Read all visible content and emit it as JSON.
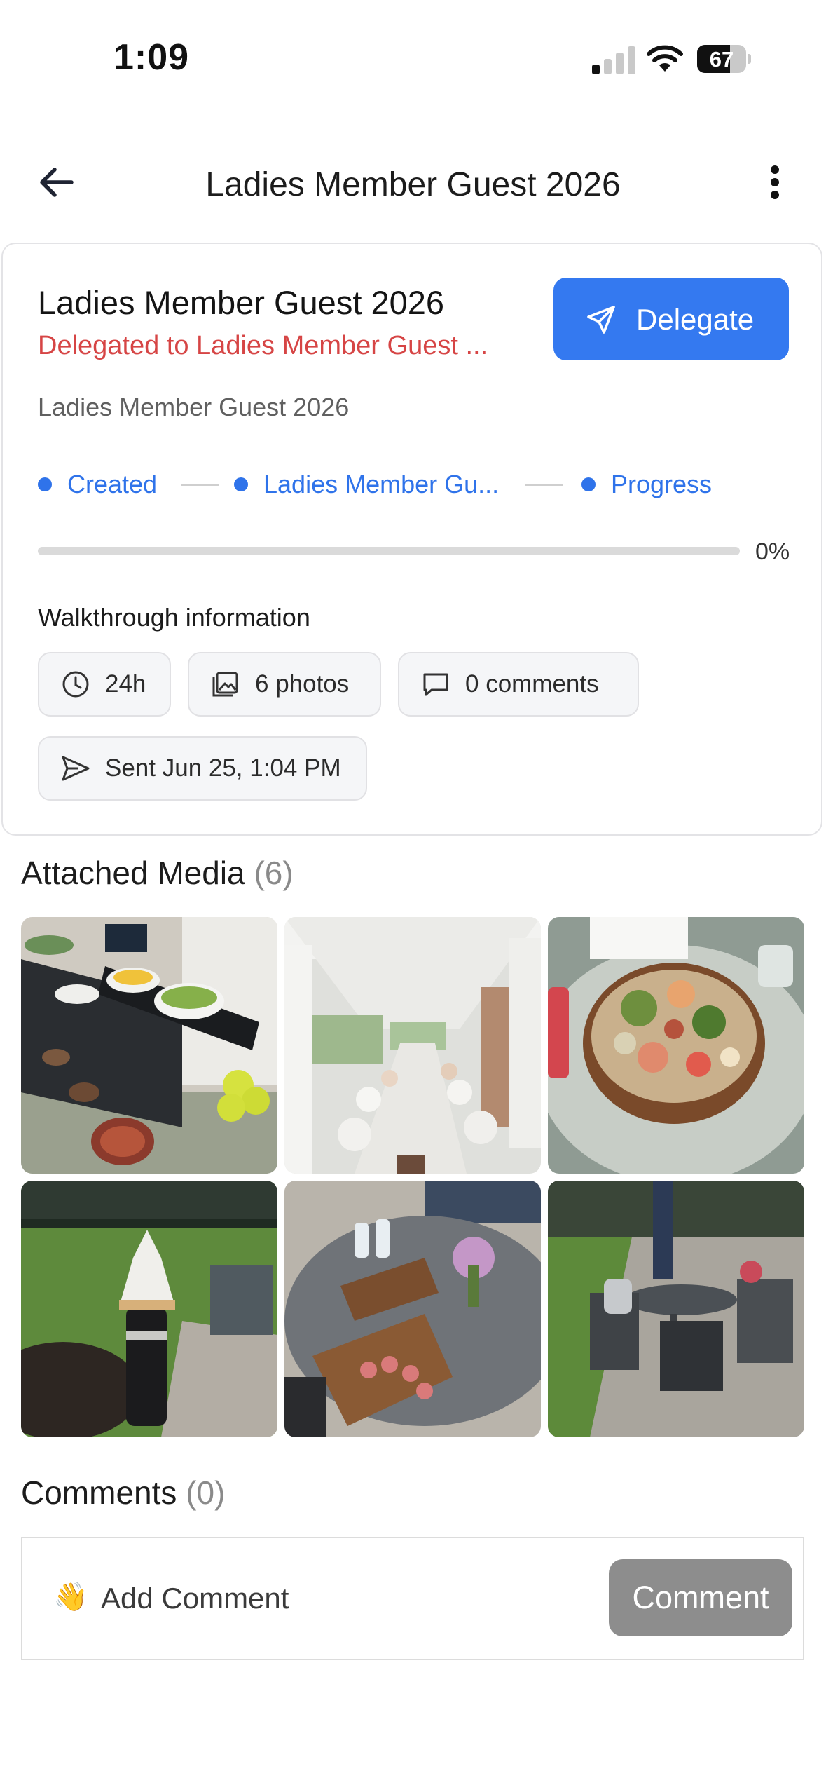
{
  "status_bar": {
    "time": "1:09",
    "battery_percent": "67",
    "battery_level": 0.67,
    "signal_bars_active": 1,
    "icons": [
      "cellular-signal-icon",
      "wifi-icon",
      "battery-icon"
    ]
  },
  "header": {
    "title": "Ladies Member Guest 2026",
    "back_icon": "arrow-left-icon",
    "menu_icon": "more-vertical-icon"
  },
  "card": {
    "title": "Ladies Member Guest 2026",
    "delegated_to": "Delegated to Ladies Member Guest ...",
    "description": "Ladies Member Guest 2026",
    "delegate_button": "Delegate",
    "delegate_icon": "send-outline-icon",
    "steps": [
      {
        "label": "Created"
      },
      {
        "label": "Ladies Member Gu..."
      },
      {
        "label": "Progress"
      }
    ],
    "progress": 0,
    "progress_label": "0%",
    "walkthrough_title": "Walkthrough information",
    "chips": [
      {
        "icon": "clock-icon",
        "label": "24h"
      },
      {
        "icon": "photos-icon",
        "label": "6 photos"
      },
      {
        "icon": "comment-icon",
        "label": "0 comments"
      },
      {
        "icon": "send-icon",
        "label": "Sent Jun 25, 1:04 PM"
      }
    ]
  },
  "media": {
    "title": "Attached Media",
    "count": "(6)",
    "photos": [
      {
        "name": "buffet-photo"
      },
      {
        "name": "porch-dining-photo"
      },
      {
        "name": "poke-bowl-photo"
      },
      {
        "name": "towel-stand-photo"
      },
      {
        "name": "patio-table-photo"
      },
      {
        "name": "patio-chairs-photo"
      }
    ]
  },
  "comments": {
    "title": "Comments",
    "count": "(0)",
    "placeholder": "Add Comment",
    "emoji": "👋",
    "button": "Comment"
  },
  "colors": {
    "accent": "#3479f0",
    "delegated_red": "#d64545",
    "comment_button": "#8d8d8d"
  }
}
